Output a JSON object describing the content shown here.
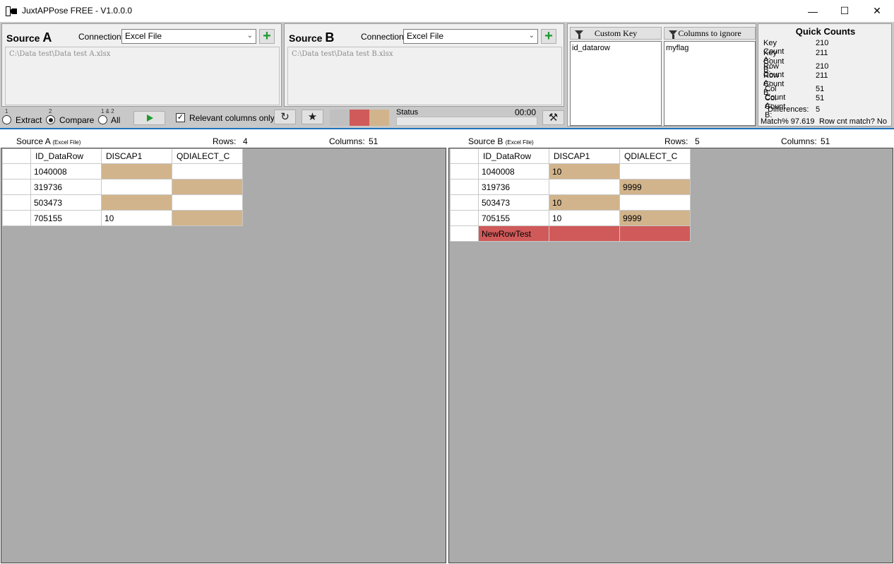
{
  "window": {
    "title": "JuxtAPPose FREE  -  V1.0.0.0",
    "min_glyph": "—",
    "max_glyph": "☐",
    "close_glyph": "✕"
  },
  "source_a": {
    "label_prefix": "Source ",
    "label_letter": "A",
    "connection_label": "Connection",
    "connection_value": "Excel File",
    "path": "C:\\Data test\\Data test A.xlsx"
  },
  "source_b": {
    "label_prefix": "Source ",
    "label_letter": "B",
    "connection_label": "Connection",
    "connection_value": "Excel File",
    "path": "C:\\Data test\\Data test B.xlsx"
  },
  "custom_key": {
    "header": "Custom Key",
    "items": [
      "id_datarow"
    ]
  },
  "columns_ignore": {
    "header": "Columns to ignore",
    "items": [
      "myflag"
    ]
  },
  "quick_counts": {
    "title": "Quick Counts",
    "key_a_label": "Key Count A:",
    "key_a": "210",
    "key_b_label": "Key Count B:",
    "key_b": "211",
    "row_a_label": "Row Count A:",
    "row_a": "210",
    "row_b_label": "Row Count B:",
    "row_b": "211",
    "col_a_label": "Col Count A:",
    "col_a": "51",
    "col_b_label": "Col Count B:",
    "col_b": "51",
    "diff_label": "Differences:",
    "diff": "5",
    "match_pct": "Match% 97.619",
    "row_cnt_match": "Row cnt match? No"
  },
  "modes": {
    "extract_num": "1",
    "extract_label": "Extract",
    "compare_num": "2",
    "compare_label": "Compare",
    "all_num": "1 & 2",
    "all_label": "All",
    "selected": "compare"
  },
  "relevant_columns_label": "Relevant columns only",
  "relevant_columns_checked": true,
  "check_glyph": "✓",
  "icons": {
    "refresh": "↻",
    "star": "★",
    "tools": "⚒"
  },
  "swatch_colors": [
    "#c0c0c0",
    "#d05a5a",
    "#d2b48c"
  ],
  "status": {
    "label": "Status",
    "time": "00:00"
  },
  "grid_a": {
    "source_label": "Source A",
    "source_type": "(Excel File)",
    "rows_label": "Rows:",
    "rows": "4",
    "cols_label": "Columns:",
    "cols": "51",
    "headers": [
      "ID_DataRow",
      "DISCAP1",
      "QDIALECT_C"
    ],
    "rows_data": [
      [
        "1040008",
        "",
        ""
      ],
      [
        "319736",
        "",
        ""
      ],
      [
        "503473",
        "",
        ""
      ],
      [
        "705155",
        "10",
        ""
      ]
    ]
  },
  "grid_b": {
    "source_label": "Source B",
    "source_type": "(Excel File)",
    "rows_label": "Rows:",
    "rows": "5",
    "cols_label": "Columns:",
    "cols": "51",
    "headers": [
      "ID_DataRow",
      "DISCAP1",
      "QDIALECT_C"
    ],
    "rows_data": [
      [
        "1040008",
        "10",
        ""
      ],
      [
        "319736",
        "",
        "9999"
      ],
      [
        "503473",
        "10",
        ""
      ],
      [
        "705155",
        "10",
        "9999"
      ],
      [
        "NewRowTest",
        "",
        ""
      ]
    ]
  }
}
